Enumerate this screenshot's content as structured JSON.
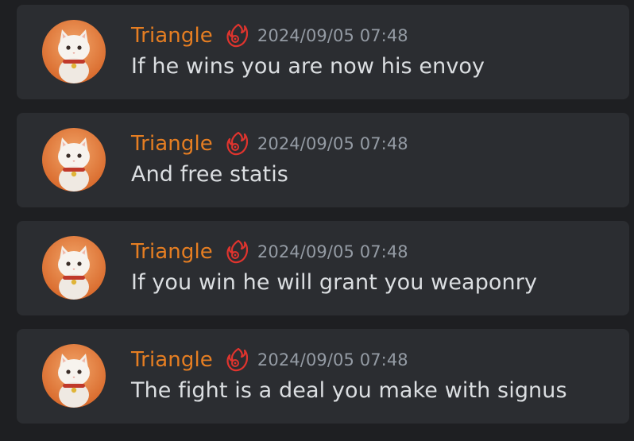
{
  "colors": {
    "background": "#1e1f22",
    "message_background": "#2b2d31",
    "username": "#e67e22",
    "timestamp": "#949ba4",
    "content": "#dbdee1",
    "role_icon": "#e0342e"
  },
  "messages": [
    {
      "username": "Triangle",
      "role_icon": "flame-ring-icon",
      "avatar": "white-cat-avatar",
      "timestamp": "2024/09/05 07:48",
      "content": "If he wins you are now his envoy"
    },
    {
      "username": "Triangle",
      "role_icon": "flame-ring-icon",
      "avatar": "white-cat-avatar",
      "timestamp": "2024/09/05 07:48",
      "content": "And free statis"
    },
    {
      "username": "Triangle",
      "role_icon": "flame-ring-icon",
      "avatar": "white-cat-avatar",
      "timestamp": "2024/09/05 07:48",
      "content": "If you win he will grant you weaponry"
    },
    {
      "username": "Triangle",
      "role_icon": "flame-ring-icon",
      "avatar": "white-cat-avatar",
      "timestamp": "2024/09/05 07:48",
      "content": "The fight is a deal you make with signus"
    }
  ]
}
